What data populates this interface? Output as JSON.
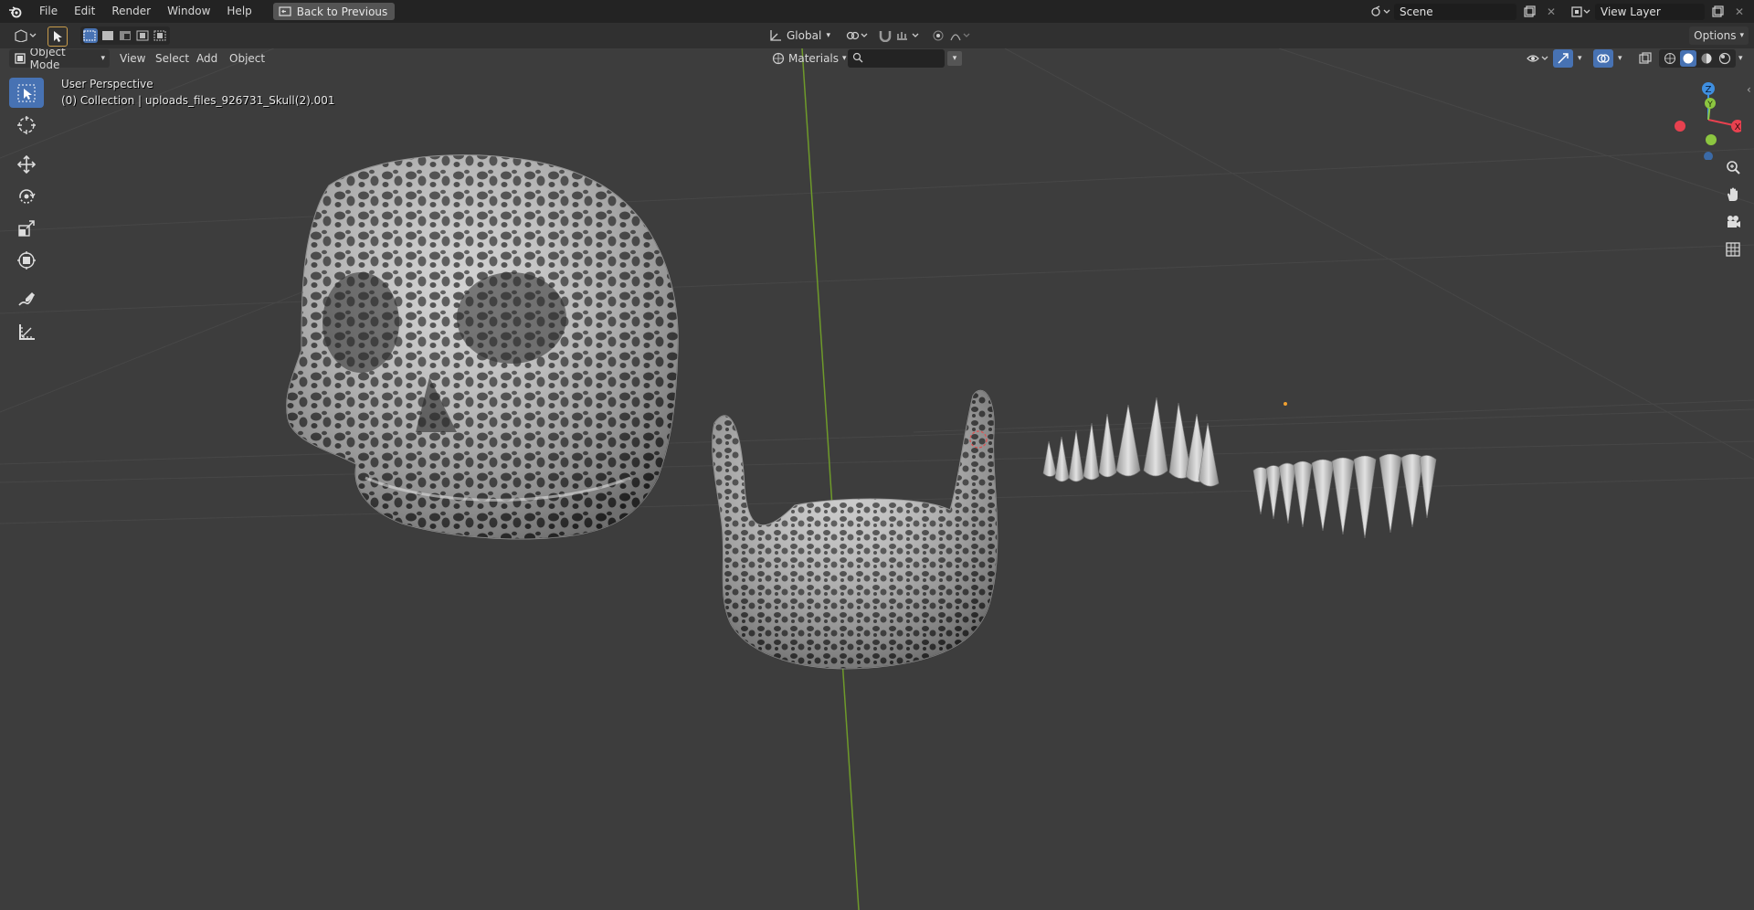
{
  "menubar": {
    "items": [
      "File",
      "Edit",
      "Render",
      "Window",
      "Help"
    ],
    "back_button": "Back to Previous",
    "scene_label": "Scene",
    "view_layer_label": "View Layer"
  },
  "header": {
    "transform_orientation": "Global",
    "options_label": "Options",
    "mode": "Object Mode",
    "menus": [
      "View",
      "Select",
      "Add",
      "Object"
    ],
    "materials_label": "Materials",
    "search_placeholder": ""
  },
  "viewport": {
    "perspective_label": "User Perspective",
    "collection_label": "(0) Collection | uploads_files_926731_Skull(2).001"
  },
  "gizmo": {
    "z": "Z",
    "y": "Y",
    "x": "X"
  },
  "colors": {
    "accent": "#4772b3",
    "axis_x": "#e8414f",
    "axis_y": "#8cc640",
    "axis_z": "#3f8fe0",
    "y_axis_line": "#6e9a2a"
  }
}
